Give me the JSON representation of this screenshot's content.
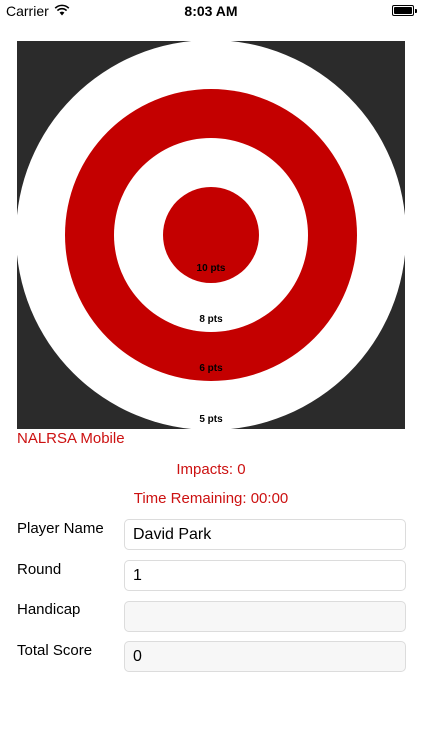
{
  "status_bar": {
    "carrier": "Carrier",
    "time": "8:03 AM",
    "battery_level": 1.0
  },
  "target": {
    "ring_labels": [
      "10 pts",
      "8 pts",
      "6 pts",
      "5 pts"
    ],
    "colors": {
      "background": "#2b2b2b",
      "red": "#c40000",
      "white": "#ffffff"
    }
  },
  "app": {
    "title": "NALRSA Mobile",
    "impacts_text": "Impacts: 0",
    "time_remaining_text": "Time Remaining: 00:00",
    "accent": "#cc1111"
  },
  "form": {
    "player_name_label": "Player Name",
    "player_name_value": "David Park",
    "round_label": "Round",
    "round_value": "1",
    "handicap_label": "Handicap",
    "handicap_value": "",
    "total_score_label": "Total Score",
    "total_score_value": "0"
  }
}
